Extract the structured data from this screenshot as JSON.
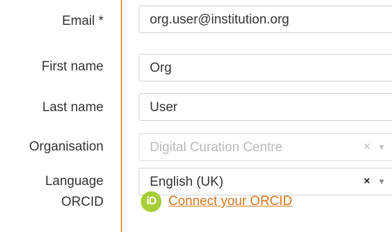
{
  "form": {
    "email": {
      "label": "Email *",
      "value": "org.user@institution.org"
    },
    "first_name": {
      "label": "First name",
      "value": "Org"
    },
    "last_name": {
      "label": "Last name",
      "value": "User"
    },
    "organisation": {
      "label": "Organisation",
      "value": "Digital Curation Centre",
      "clear_glyph": "×",
      "arrow_glyph": "▼"
    },
    "language": {
      "label": "Language",
      "value": "English (UK)",
      "clear_glyph": "×",
      "arrow_glyph": "▼"
    },
    "orcid": {
      "label": "ORCID",
      "icon_text": "iD",
      "link_text": "Connect your ORCID"
    }
  },
  "colors": {
    "accent": "#e8a23a",
    "orcid_green": "#a6ce39",
    "link": "#d9741c"
  }
}
